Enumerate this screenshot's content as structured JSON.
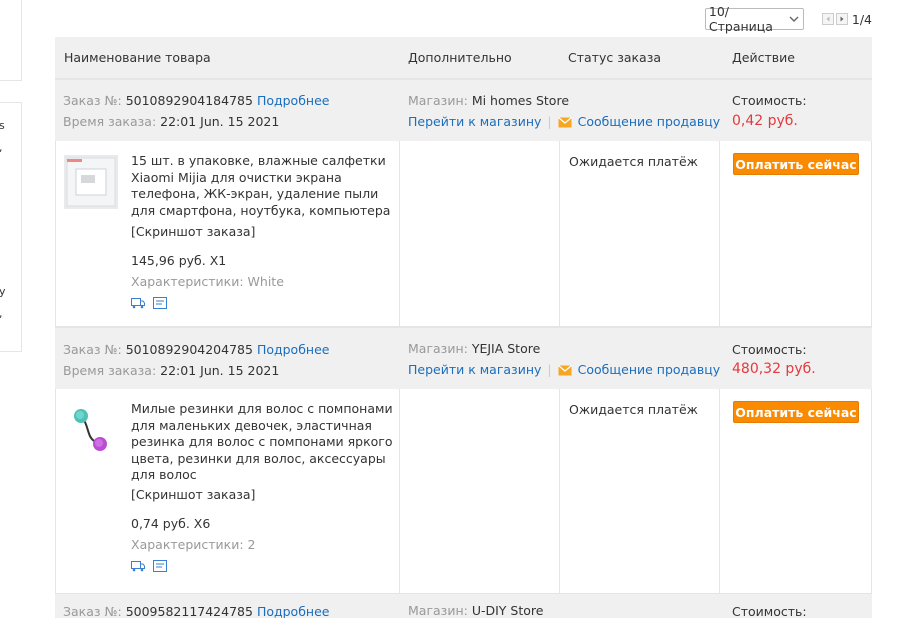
{
  "left_fragments": [
    "s",
    ",",
    "y",
    ","
  ],
  "pager": {
    "per_page": "10/Страница",
    "page_count": "1/4"
  },
  "columns": {
    "name": "Наименование товара",
    "extra": "Дополнительно",
    "status": "Статус заказа",
    "action": "Действие"
  },
  "labels": {
    "order_no": "Заказ №:",
    "order_time": "Время заказа:",
    "details": "Подробнее",
    "store": "Магазин:",
    "go_store": "Перейти к магазину",
    "message_seller": "Сообщение продавцу",
    "cost": "Стоимость:",
    "screenshot": "[Скриншот заказа]",
    "characteristics": "Характеристики:",
    "pay_now": "Оплатить сейчас"
  },
  "orders": [
    {
      "number": "5010892904184785",
      "time": "22:01 Jun. 15 2021",
      "store": "Mi homes Store",
      "cost": "0,42 руб.",
      "status": "Ожидается платёж",
      "product_title": "15 шт. в упаковке, влажные салфетки Xiaomi Mijia для очистки экрана телефона, ЖК-экран, удаление пыли для смартфона, ноутбука, компьютера",
      "price_qty": "145,96 руб. X1",
      "characteristic": "White"
    },
    {
      "number": "5010892904204785",
      "time": "22:01 Jun. 15 2021",
      "store": "YEJIA Store",
      "cost": "480,32 руб.",
      "status": "Ожидается платёж",
      "product_title": "Милые резинки для волос с помпонами для маленьких девочек, эластичная резинка для волос с помпонами яркого цвета, резинки для волос, аксессуары для волос",
      "price_qty": "0,74 руб. X6",
      "characteristic": "2"
    },
    {
      "number": "5009582117424785",
      "store": "U-DIY Store"
    }
  ],
  "colors": {
    "accent_orange": "#fa8a00",
    "link_blue": "#1a6ebd",
    "price_red": "#e4393c",
    "header_gray": "#f0f0f0"
  }
}
